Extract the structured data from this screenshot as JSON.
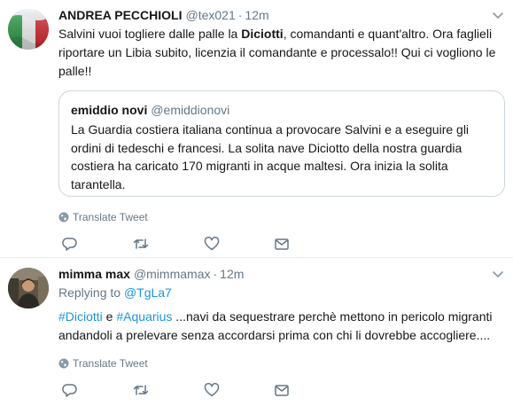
{
  "tweets": [
    {
      "name": "ANDREA PECCHIOLI",
      "handle": "@tex021",
      "separator": "·",
      "time": "12m",
      "text_before": "Salvini vuoi togliere dalle palle la ",
      "text_highlight": "Diciotti",
      "text_after": ", comandanti e quant'altro. Ora faglieli riportare un Libia subito, licenzia il comandante e processalo!! Qui ci vogliono le palle!!",
      "quote": {
        "name": "emiddio novi",
        "handle": "@emiddionovi",
        "text": "La Guardia costiera italiana continua a provocare Salvini e a eseguire gli ordini di tedeschi e francesi. La solita nave Diciotto della nostra guardia costiera ha  caricato 170 migranti in acque maltesi. Ora inizia la solita tarantella."
      },
      "translate": "Translate Tweet"
    },
    {
      "name": "mimma max",
      "handle": "@mimmamax",
      "separator": "·",
      "time": "12m",
      "replying_prefix": "Replying to ",
      "replying_to": "@TgLa7",
      "tag1": "#Diciotti",
      "joiner": " e ",
      "tag2": "#Aquarius",
      "text_after": " ...navi da sequestrare perchè mettono in pericolo migranti andandoli a prelevare senza accordarsi prima con chi li dovrebbe accogliere....",
      "translate": "Translate Tweet"
    }
  ],
  "colors": {
    "text": "#14171a",
    "muted": "#657786",
    "link": "#1b95e0",
    "border": "#e6ecf0"
  },
  "icons": [
    "italy-flag-avatar",
    "person-photo-avatar",
    "chevron-down-icon",
    "globe-icon",
    "reply-icon",
    "retweet-icon",
    "like-icon",
    "direct-message-icon"
  ]
}
